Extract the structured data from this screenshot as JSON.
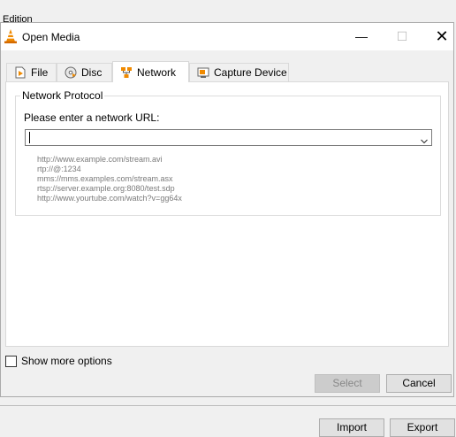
{
  "background_window": {
    "menu_label": "Edition"
  },
  "dialog": {
    "title": "Open Media",
    "window_controls": {
      "minimize": "—",
      "maximize": "☐",
      "close": "✕"
    }
  },
  "tabs": [
    {
      "label": "File",
      "icon": "file-icon"
    },
    {
      "label": "Disc",
      "icon": "disc-icon"
    },
    {
      "label": "Network",
      "icon": "network-icon",
      "active": true
    },
    {
      "label": "Capture Device",
      "icon": "capture-device-icon"
    }
  ],
  "network": {
    "group_title": "Network Protocol",
    "url_label": "Please enter a network URL:",
    "url_value": "",
    "examples": [
      "http://www.example.com/stream.avi",
      "rtp://@:1234",
      "mms://mms.examples.com/stream.asx",
      "rtsp://server.example.org:8080/test.sdp",
      "http://www.yourtube.com/watch?v=gg64x"
    ]
  },
  "options": {
    "show_more_label": "Show more options",
    "show_more_checked": false
  },
  "buttons": {
    "select": "Select",
    "cancel": "Cancel",
    "import": "Import",
    "export": "Export"
  },
  "colors": {
    "vlc_orange": "#f08a00",
    "select_disabled_bg": "#cccccc"
  }
}
